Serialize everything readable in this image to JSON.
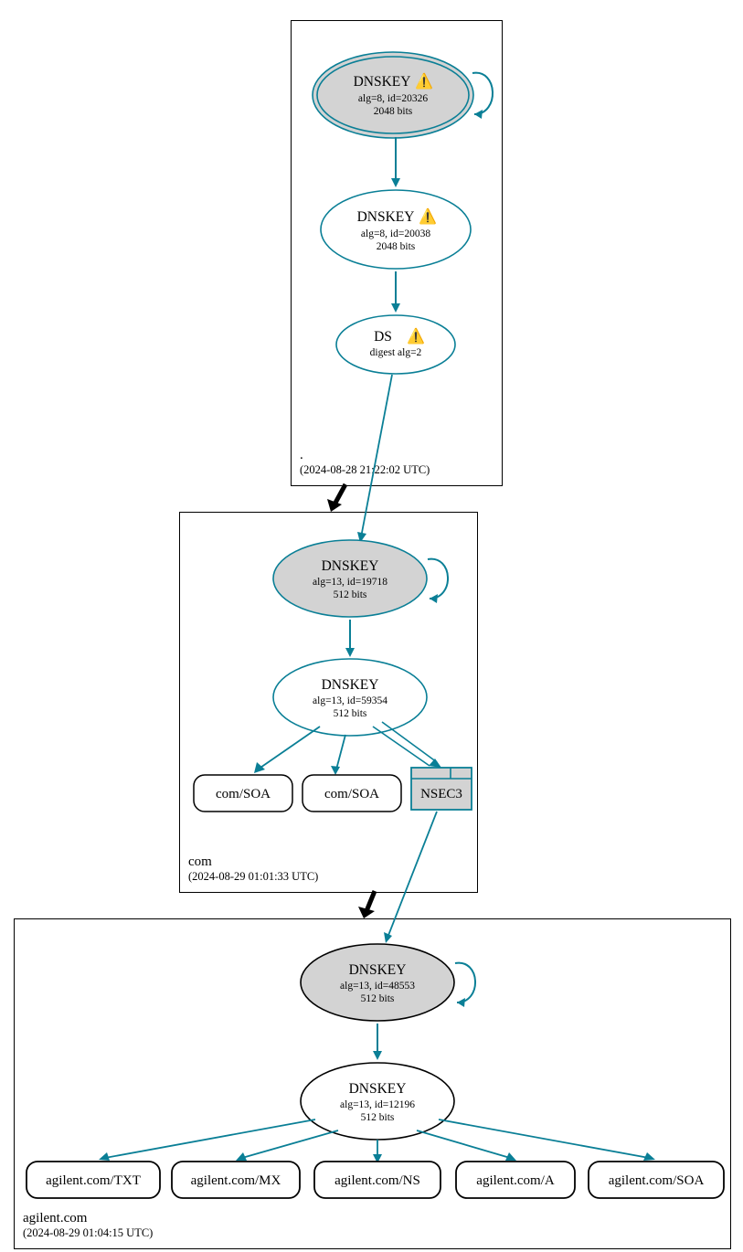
{
  "colors": {
    "teal": "#0a7f96",
    "grey_fill": "#d3d3d3"
  },
  "zones": {
    "root": {
      "name": ".",
      "timestamp": "(2024-08-28 21:22:02 UTC)"
    },
    "com": {
      "name": "com",
      "timestamp": "(2024-08-29 01:01:33 UTC)"
    },
    "agilent": {
      "name": "agilent.com",
      "timestamp": "(2024-08-29 01:04:15 UTC)"
    }
  },
  "nodes": {
    "root_ksk": {
      "title": "DNSKEY",
      "line1": "alg=8, id=20326",
      "line2": "2048 bits",
      "warn": "⚠️"
    },
    "root_zsk": {
      "title": "DNSKEY",
      "line1": "alg=8, id=20038",
      "line2": "2048 bits",
      "warn": "⚠️"
    },
    "root_ds": {
      "title": "DS",
      "line1": "digest alg=2",
      "warn": "⚠️"
    },
    "com_ksk": {
      "title": "DNSKEY",
      "line1": "alg=13, id=19718",
      "line2": "512 bits"
    },
    "com_zsk": {
      "title": "DNSKEY",
      "line1": "alg=13, id=59354",
      "line2": "512 bits"
    },
    "com_soa1": {
      "label": "com/SOA"
    },
    "com_soa2": {
      "label": "com/SOA"
    },
    "com_nsec3": {
      "label": "NSEC3"
    },
    "agilent_ksk": {
      "title": "DNSKEY",
      "line1": "alg=13, id=48553",
      "line2": "512 bits"
    },
    "agilent_zsk": {
      "title": "DNSKEY",
      "line1": "alg=13, id=12196",
      "line2": "512 bits"
    },
    "agilent_txt": {
      "label": "agilent.com/TXT"
    },
    "agilent_mx": {
      "label": "agilent.com/MX"
    },
    "agilent_ns": {
      "label": "agilent.com/NS"
    },
    "agilent_a": {
      "label": "agilent.com/A"
    },
    "agilent_soa": {
      "label": "agilent.com/SOA"
    }
  }
}
